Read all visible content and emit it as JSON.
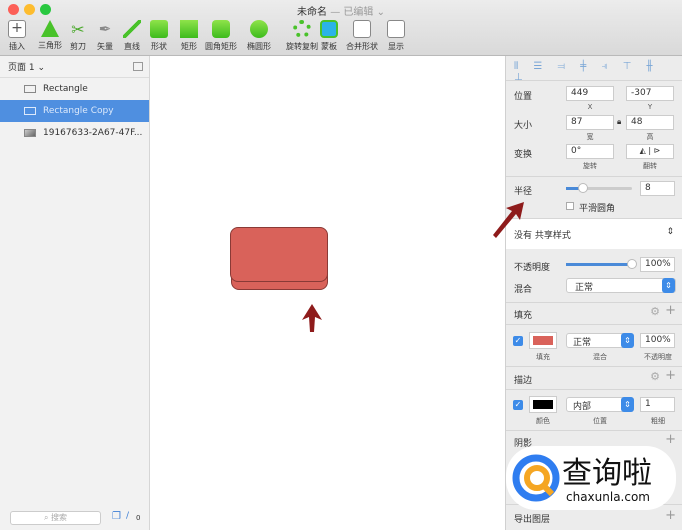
{
  "window": {
    "title": "未命名",
    "status": "— 已编辑 ⌄"
  },
  "toolbar": [
    {
      "label": "插入",
      "icon": "plus-icon"
    },
    {
      "label": "三角形",
      "icon": "triangle-icon"
    },
    {
      "label": "剪刀",
      "icon": "scissors-icon"
    },
    {
      "label": "矢量",
      "icon": "pen-icon"
    },
    {
      "label": "直线",
      "icon": "line-icon"
    },
    {
      "label": "形状",
      "icon": "shapes-icon"
    },
    {
      "label": "矩形",
      "icon": "rectangle-icon"
    },
    {
      "label": "圆角矩形",
      "icon": "rounded-rect-icon"
    },
    {
      "label": "椭圆形",
      "icon": "oval-icon"
    },
    {
      "label": "旋转复制",
      "icon": "rotate-copy-icon"
    },
    {
      "label": "蒙板",
      "icon": "mask-icon"
    },
    {
      "label": "合并形状",
      "icon": "combine-icon"
    },
    {
      "label": "显示",
      "icon": "view-icon"
    }
  ],
  "sidebar": {
    "page": "页面 1 ⌄",
    "layers": [
      "Rectangle",
      "Rectangle Copy",
      "19167633-2A67-47F..."
    ],
    "search_placeholder": "搜索",
    "count": "0"
  },
  "inspector": {
    "position": {
      "label": "位置",
      "x": "449",
      "y": "-307",
      "x_cap": "X",
      "y_cap": "Y"
    },
    "size": {
      "label": "大小",
      "w": "87",
      "h": "48",
      "w_cap": "宽",
      "h_cap": "高"
    },
    "transform": {
      "label": "变换",
      "rotate": "0°",
      "rotate_cap": "旋转",
      "flip_cap": "翻转"
    },
    "radius": {
      "label": "半径",
      "value": "8",
      "smooth": "平滑圆角",
      "slider": 0.25
    },
    "shared_style": "没有 共享样式",
    "opacity": {
      "label": "不透明度",
      "value": "100%",
      "slider": 1.0
    },
    "blend": {
      "label": "混合",
      "value": "正常"
    },
    "fill": {
      "header": "填充",
      "color": "#d9625a",
      "blend": "正常",
      "opacity": "100%",
      "cap_fill": "填充",
      "cap_blend": "混合",
      "cap_opacity": "不透明度"
    },
    "border": {
      "header": "描边",
      "color": "#000000",
      "position": "内部",
      "width": "1",
      "cap_color": "颜色",
      "cap_pos": "位置",
      "cap_width": "粗细"
    },
    "shadow_header": "阴影",
    "export": "导出图层"
  },
  "watermark": {
    "text": "查询啦",
    "url": "chaxunla.com"
  }
}
